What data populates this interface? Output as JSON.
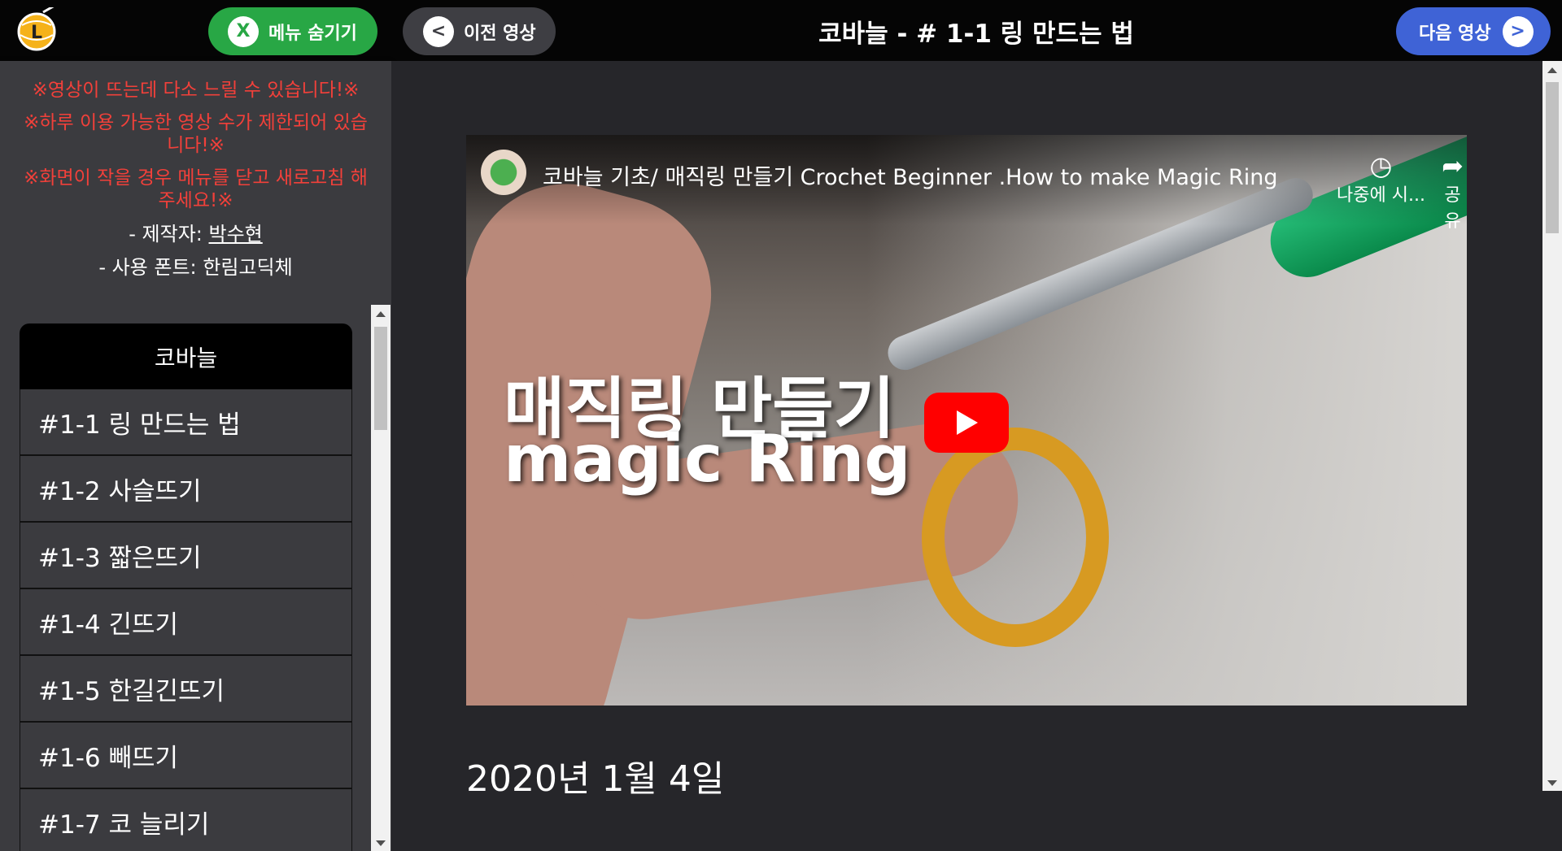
{
  "header": {
    "hide_menu_label": "메뉴 숨기기",
    "hide_menu_icon": "X",
    "prev_label": "이전 영상",
    "prev_icon": "<",
    "title": "코바늘 - # 1-1 링 만드는 법",
    "next_label": "다음 영상",
    "next_icon": ">",
    "logo_letter": "L"
  },
  "notice": {
    "lines": [
      "※영상이 뜨는데 다소 느릴 수 있습니다!※",
      "※하루 이용 가능한 영상 수가 제한되어 있습니다!※",
      "※화면이 작을 경우 메뉴를 닫고 새로고침 해주세요!※"
    ],
    "creator_prefix": "- 제작자: ",
    "creator_name": "박수현",
    "font_line": "- 사용 폰트: 한림고딕체"
  },
  "menu": {
    "header": "코바늘",
    "items": [
      {
        "label": "#1-1 링 만드는 법"
      },
      {
        "label": "#1-2 사슬뜨기"
      },
      {
        "label": "#1-3 짧은뜨기"
      },
      {
        "label": "#1-4 긴뜨기"
      },
      {
        "label": "#1-5 한길긴뜨기"
      },
      {
        "label": "#1-6 빼뜨기"
      },
      {
        "label": "#1-7 코 늘리기"
      }
    ]
  },
  "video": {
    "title": "코바늘 기초/ 매직링 만들기 Crochet Beginner .How to make Magic Ring",
    "watch_later_label": "나중에 시...",
    "share_label": "공유",
    "overlay_line1": "매직링 만들기",
    "overlay_line2": "magic Ring"
  },
  "date": "2020년 1월 4일",
  "colors": {
    "hide_button": "#28a745",
    "prev_button": "#3e3e43",
    "next_button": "#3f63d6",
    "warning_text": "#f2403a"
  }
}
